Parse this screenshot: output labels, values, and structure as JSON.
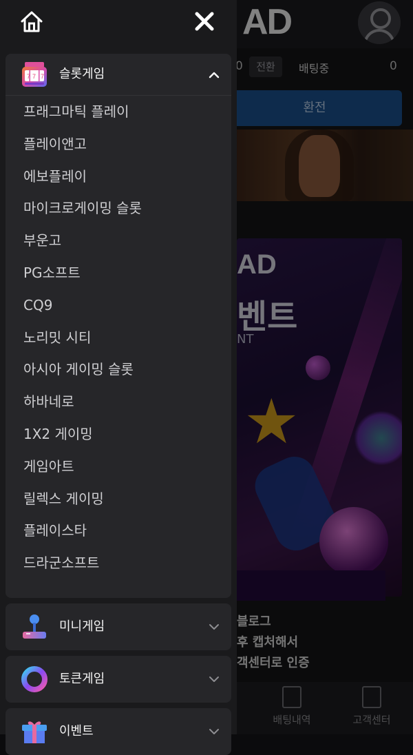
{
  "background": {
    "logo": "AD",
    "balance_zero": "0",
    "convert_chip": "전환",
    "betting_label": "배팅중",
    "betting_zero": "0",
    "convert_button": "환전",
    "promo_logo": "AD",
    "promo_title": "벤트",
    "promo_sub": "NT",
    "promo_lines": [
      "블로그",
      "후 캡처해서",
      "객센터로 인증"
    ],
    "bottom_nav": [
      "배팅내역",
      "고객센터"
    ]
  },
  "drawer": {
    "home_icon": "home-icon",
    "close_icon": "close-icon",
    "categories": [
      {
        "label": "슬롯게임",
        "icon": "slot-machine-icon",
        "expanded": true,
        "items": [
          "프래그마틱 플레이",
          "플레이앤고",
          "에보플레이",
          "마이크로게이밍 슬롯",
          "부운고",
          "PG소프트",
          "CQ9",
          "노리밋 시티",
          "아시아 게이밍 슬롯",
          "하바네로",
          "1X2 게이밍",
          "게임아트",
          "릴렉스 게이밍",
          "플레이스타",
          "드라군소프트"
        ]
      },
      {
        "label": "미니게임",
        "icon": "joystick-icon",
        "expanded": false
      },
      {
        "label": "토큰게임",
        "icon": "token-ring-icon",
        "expanded": false
      },
      {
        "label": "이벤트",
        "icon": "gift-icon",
        "expanded": false
      }
    ]
  },
  "colors": {
    "drawer_bg": "#1a1a1c",
    "card_bg": "#262629",
    "accent_blue": "#1a4f8a"
  }
}
